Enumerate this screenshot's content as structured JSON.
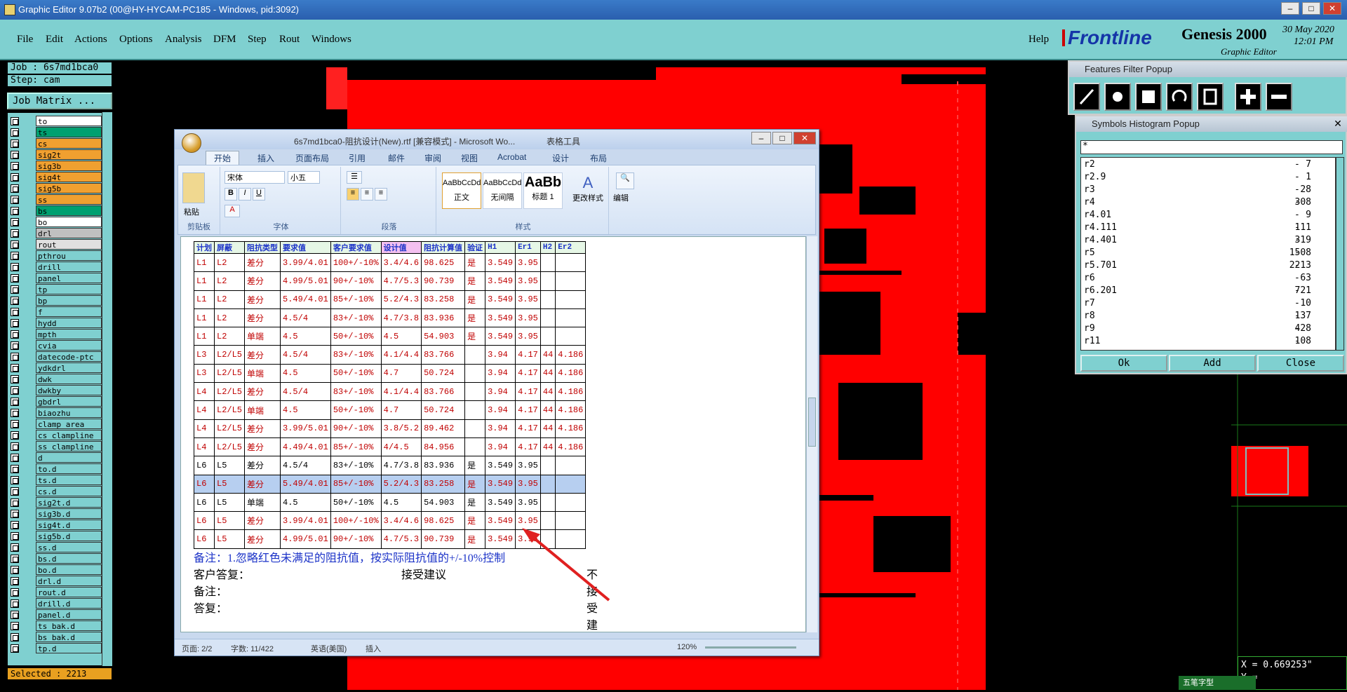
{
  "window": {
    "title": "Graphic Editor 9.07b2 (00@HY-HYCAM-PC185 - Windows, pid:3092)"
  },
  "menu": {
    "items": [
      "File",
      "Edit",
      "Actions",
      "Options",
      "Analysis",
      "DFM",
      "Step",
      "Rout",
      "Windows"
    ],
    "help": "Help"
  },
  "brand": {
    "logo": "Frontline",
    "product": "Genesis 2000",
    "subtitle": "Graphic Editor",
    "date": "30 May 2020",
    "time": "12:01 PM"
  },
  "left": {
    "job": "Job :  6s7md1bca0",
    "step": "Step: cam",
    "job_matrix": "Job Matrix ...",
    "layers": [
      {
        "name": "to",
        "color": "#ffffff"
      },
      {
        "name": "ts",
        "color": "#00a070"
      },
      {
        "name": "cs",
        "color": "#f0a030"
      },
      {
        "name": "sig2t",
        "color": "#f0a030"
      },
      {
        "name": "sig3b",
        "color": "#f0a030"
      },
      {
        "name": "sig4t",
        "color": "#f0a030"
      },
      {
        "name": "sig5b",
        "color": "#f0a030"
      },
      {
        "name": "ss",
        "color": "#f0a030"
      },
      {
        "name": "bs",
        "color": "#00a070"
      },
      {
        "name": "bo",
        "color": "#ffffff"
      },
      {
        "name": "drl",
        "color": "#c0c0c0"
      },
      {
        "name": "rout",
        "color": "#e0e0e0"
      },
      {
        "name": "pthrou",
        "color": "#7fd0d0"
      },
      {
        "name": "drill",
        "color": "#7fd0d0"
      },
      {
        "name": "panel",
        "color": "#7fd0d0"
      },
      {
        "name": "tp",
        "color": "#7fd0d0"
      },
      {
        "name": "bp",
        "color": "#7fd0d0"
      },
      {
        "name": "f",
        "color": "#7fd0d0"
      },
      {
        "name": "hydd",
        "color": "#7fd0d0"
      },
      {
        "name": "mpth",
        "color": "#7fd0d0"
      },
      {
        "name": "cvia",
        "color": "#7fd0d0"
      },
      {
        "name": "datecode-ptc",
        "color": "#7fd0d0"
      },
      {
        "name": "ydkdrl",
        "color": "#7fd0d0"
      },
      {
        "name": "dwk",
        "color": "#7fd0d0"
      },
      {
        "name": "dwkby",
        "color": "#7fd0d0"
      },
      {
        "name": "gbdrl",
        "color": "#7fd0d0"
      },
      {
        "name": "biaozhu",
        "color": "#7fd0d0"
      },
      {
        "name": "clamp_area",
        "color": "#7fd0d0"
      },
      {
        "name": "cs_clampline",
        "color": "#7fd0d0"
      },
      {
        "name": "ss_clampline",
        "color": "#7fd0d0"
      },
      {
        "name": "d",
        "color": "#7fd0d0"
      },
      {
        "name": "to.d",
        "color": "#7fd0d0"
      },
      {
        "name": "ts.d",
        "color": "#7fd0d0"
      },
      {
        "name": "cs.d",
        "color": "#7fd0d0"
      },
      {
        "name": "sig2t.d",
        "color": "#7fd0d0"
      },
      {
        "name": "sig3b.d",
        "color": "#7fd0d0"
      },
      {
        "name": "sig4t.d",
        "color": "#7fd0d0"
      },
      {
        "name": "sig5b.d",
        "color": "#7fd0d0"
      },
      {
        "name": "ss.d",
        "color": "#7fd0d0"
      },
      {
        "name": "bs.d",
        "color": "#7fd0d0"
      },
      {
        "name": "bo.d",
        "color": "#7fd0d0"
      },
      {
        "name": "drl.d",
        "color": "#7fd0d0"
      },
      {
        "name": "rout.d",
        "color": "#7fd0d0"
      },
      {
        "name": "drill.d",
        "color": "#7fd0d0"
      },
      {
        "name": "panel.d",
        "color": "#7fd0d0"
      },
      {
        "name": "ts_bak.d",
        "color": "#7fd0d0"
      },
      {
        "name": "bs_bak.d",
        "color": "#7fd0d0"
      },
      {
        "name": "tp.d",
        "color": "#7fd0d0"
      }
    ],
    "selected": "Selected : 2213"
  },
  "word": {
    "title": "6s7md1bca0-阻抗设计(New).rtf [兼容模式] - Microsoft Wo...",
    "context_tab": "表格工具",
    "tabs": [
      "开始",
      "插入",
      "页面布局",
      "引用",
      "邮件",
      "审阅",
      "视图",
      "Acrobat",
      "设计",
      "布局"
    ],
    "ribbon": {
      "clipboard": "剪贴板",
      "paste": "粘贴",
      "font_group": "字体",
      "font": "宋体",
      "size": "小五",
      "paragraph": "段落",
      "styles": "样式",
      "style_items": [
        {
          "preview": "AaBbCcDd",
          "name": "正文"
        },
        {
          "preview": "AaBbCcDd",
          "name": "无间隔"
        },
        {
          "preview": "AaBb",
          "name": "标题 1"
        }
      ],
      "change_styles": "更改样式",
      "edit": "编辑"
    },
    "table_header": [
      "计划",
      "屏蔽",
      "阻抗类型",
      "要求值",
      "客户要求值",
      "设计值",
      "阻抗计算值",
      "验证",
      "H1",
      "Er1",
      "H2",
      "Er2"
    ],
    "rows": [
      {
        "cls": "red",
        "cells": [
          "L1",
          "L2",
          "差分",
          "3.99/4.01",
          "100+/-10%",
          "3.4/4.6",
          "98.625",
          "是",
          "3.549",
          "3.95",
          "",
          ""
        ]
      },
      {
        "cls": "red",
        "cells": [
          "L1",
          "L2",
          "差分",
          "4.99/5.01",
          "90+/-10%",
          "4.7/5.3",
          "90.739",
          "是",
          "3.549",
          "3.95",
          "",
          ""
        ]
      },
      {
        "cls": "red",
        "cells": [
          "L1",
          "L2",
          "差分",
          "5.49/4.01",
          "85+/-10%",
          "5.2/4.3",
          "83.258",
          "是",
          "3.549",
          "3.95",
          "",
          ""
        ]
      },
      {
        "cls": "red",
        "cells": [
          "L1",
          "L2",
          "差分",
          "4.5/4",
          "83+/-10%",
          "4.7/3.8",
          "83.936",
          "是",
          "3.549",
          "3.95",
          "",
          ""
        ]
      },
      {
        "cls": "red",
        "cells": [
          "L1",
          "L2",
          "单端",
          "4.5",
          "50+/-10%",
          "4.5",
          "54.903",
          "是",
          "3.549",
          "3.95",
          "",
          ""
        ]
      },
      {
        "cls": "red",
        "cells": [
          "L3",
          "L2/L5",
          "差分",
          "4.5/4",
          "83+/-10%",
          "4.1/4.4",
          "83.766",
          "",
          "3.94",
          "4.17",
          "44",
          "4.186"
        ]
      },
      {
        "cls": "red",
        "cells": [
          "L3",
          "L2/L5",
          "单端",
          "4.5",
          "50+/-10%",
          "4.7",
          "50.724",
          "",
          "3.94",
          "4.17",
          "44",
          "4.186"
        ]
      },
      {
        "cls": "red",
        "cells": [
          "L4",
          "L2/L5",
          "差分",
          "4.5/4",
          "83+/-10%",
          "4.1/4.4",
          "83.766",
          "",
          "3.94",
          "4.17",
          "44",
          "4.186"
        ]
      },
      {
        "cls": "red",
        "cells": [
          "L4",
          "L2/L5",
          "单端",
          "4.5",
          "50+/-10%",
          "4.7",
          "50.724",
          "",
          "3.94",
          "4.17",
          "44",
          "4.186"
        ]
      },
      {
        "cls": "red",
        "cells": [
          "L4",
          "L2/L5",
          "差分",
          "3.99/5.01",
          "90+/-10%",
          "3.8/5.2",
          "89.462",
          "",
          "3.94",
          "4.17",
          "44",
          "4.186"
        ]
      },
      {
        "cls": "red",
        "cells": [
          "L4",
          "L2/L5",
          "差分",
          "4.49/4.01",
          "85+/-10%",
          "4/4.5",
          "84.956",
          "",
          "3.94",
          "4.17",
          "44",
          "4.186"
        ]
      },
      {
        "cls": "black",
        "cells": [
          "L6",
          "L5",
          "差分",
          "4.5/4",
          "83+/-10%",
          "4.7/3.8",
          "83.936",
          "是",
          "3.549",
          "3.95",
          "",
          ""
        ]
      },
      {
        "cls": "sel",
        "cells": [
          "L6",
          "L5",
          "差分",
          "5.49/4.01",
          "85+/-10%",
          "5.2/4.3",
          "83.258",
          "是",
          "3.549",
          "3.95",
          "",
          ""
        ]
      },
      {
        "cls": "black",
        "cells": [
          "L6",
          "L5",
          "单端",
          "4.5",
          "50+/-10%",
          "4.5",
          "54.903",
          "是",
          "3.549",
          "3.95",
          "",
          ""
        ]
      },
      {
        "cls": "red",
        "cells": [
          "L6",
          "L5",
          "差分",
          "3.99/4.01",
          "100+/-10%",
          "3.4/4.6",
          "98.625",
          "是",
          "3.549",
          "3.95",
          "",
          ""
        ]
      },
      {
        "cls": "red",
        "cells": [
          "L6",
          "L5",
          "差分",
          "4.99/5.01",
          "90+/-10%",
          "4.7/5.3",
          "90.739",
          "是",
          "3.549",
          "3.95",
          "",
          ""
        ]
      }
    ],
    "notes": {
      "remark": "备注：1.忽略红色未满足的阻抗值，按实际阻抗值的+/-10%控制",
      "reply": "客户答复：",
      "accept": "接受建议",
      "reject": "不接受建议",
      "remark2": "备注：",
      "answer": "答复："
    },
    "status": {
      "page": "页面: 2/2",
      "words": "字数: 11/422",
      "lang": "英语(美国)",
      "mode": "插入",
      "zoom": "120%"
    }
  },
  "features_filter": {
    "title": "Features Filter Popup"
  },
  "symbols": {
    "title": "Symbols Histogram Popup",
    "filter": "*",
    "items": [
      {
        "name": "r2",
        "count": "7"
      },
      {
        "name": "r2.9",
        "count": "1"
      },
      {
        "name": "r3",
        "count": "28"
      },
      {
        "name": "r4",
        "count": "308"
      },
      {
        "name": "r4.01",
        "count": "9"
      },
      {
        "name": "r4.111",
        "count": "111"
      },
      {
        "name": "r4.401",
        "count": "319"
      },
      {
        "name": "r5",
        "count": "1508"
      },
      {
        "name": "r5.701",
        "count": "2213"
      },
      {
        "name": "r6",
        "count": "63"
      },
      {
        "name": "r6.201",
        "count": "721"
      },
      {
        "name": "r7",
        "count": "10"
      },
      {
        "name": "r8",
        "count": "137"
      },
      {
        "name": "r9",
        "count": "428"
      },
      {
        "name": "r11",
        "count": "108"
      }
    ],
    "ok": "Ok",
    "add": "Add",
    "close": "Close"
  },
  "coords": {
    "x": "X = 0.669253\"",
    "y": "Y ="
  },
  "ime": "五笔字型"
}
